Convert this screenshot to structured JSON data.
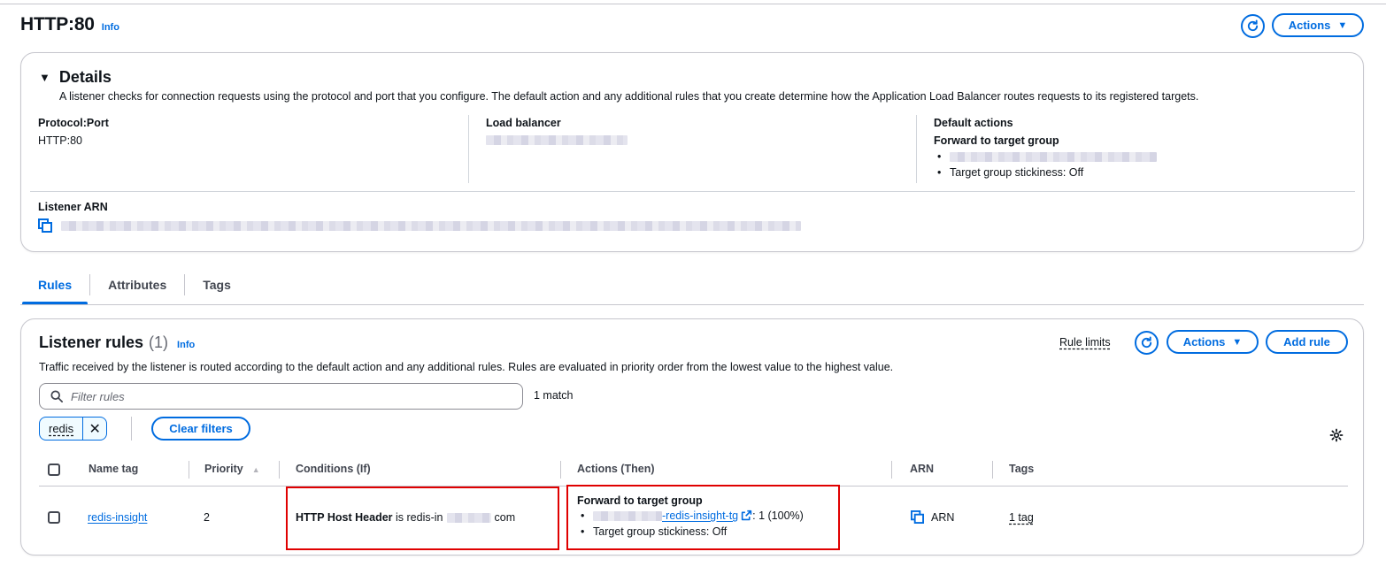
{
  "header": {
    "title": "HTTP:80",
    "info": "Info",
    "actions_label": "Actions"
  },
  "details": {
    "heading": "Details",
    "description": "A listener checks for connection requests using the protocol and port that you configure. The default action and any additional rules that you create determine how the Application Load Balancer routes requests to its registered targets.",
    "protocol_port": {
      "label": "Protocol:Port",
      "value": "HTTP:80"
    },
    "load_balancer": {
      "label": "Load balancer"
    },
    "default_actions": {
      "label": "Default actions",
      "action": "Forward to target group",
      "stickiness": "Target group stickiness: Off"
    },
    "listener_arn": {
      "label": "Listener ARN"
    }
  },
  "tabs": [
    "Rules",
    "Attributes",
    "Tags"
  ],
  "rules": {
    "title": "Listener rules",
    "count": "(1)",
    "info": "Info",
    "description": "Traffic received by the listener is routed according to the default action and any additional rules. Rules are evaluated in priority order from the lowest value to the highest value.",
    "rule_limits": "Rule limits",
    "actions_label": "Actions",
    "add_rule": "Add rule",
    "filter_placeholder": "Filter rules",
    "match_count": "1 match",
    "filter_token": "redis",
    "clear_filters": "Clear filters",
    "columns": [
      "Name tag",
      "Priority",
      "Conditions (If)",
      "Actions (Then)",
      "ARN",
      "Tags"
    ],
    "row": {
      "name_tag": "redis-insight",
      "priority": "2",
      "condition_key": "HTTP Host Header",
      "condition_op": "is",
      "condition_val_start": "redis-in",
      "condition_val_end": "com",
      "action_title": "Forward to target group",
      "target_suffix": "-redis-insight-tg",
      "weight": ": 1 (100%)",
      "stickiness": "Target group stickiness: Off",
      "arn": "ARN",
      "tags": "1 tag"
    }
  },
  "colors": {
    "accent": "#006ce0",
    "highlight": "#e00000",
    "border": "#c6c6cd"
  }
}
